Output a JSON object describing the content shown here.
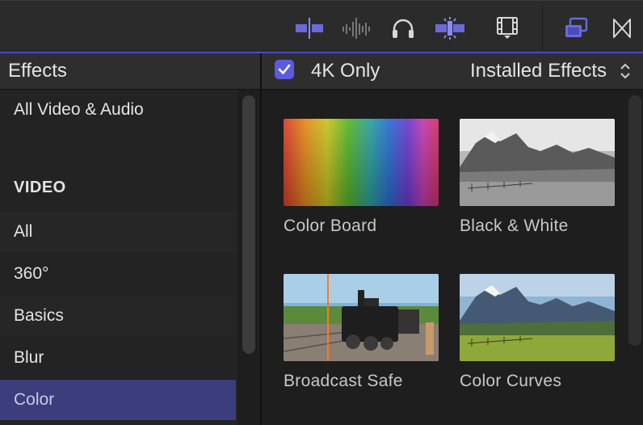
{
  "toolbar": {
    "icons": [
      "split-edit-icon",
      "audio-skimming-icon",
      "headphones-icon",
      "snapping-icon",
      "inspector-filmstrip-icon",
      "window-layout-icon",
      "transitions-bowtie-icon"
    ],
    "accent": "#6666e0"
  },
  "effects_panel": {
    "title": "Effects",
    "items": [
      {
        "label": "All Video & Audio",
        "kind": "item"
      },
      {
        "label": "VIDEO",
        "kind": "header"
      },
      {
        "label": "All",
        "kind": "item"
      },
      {
        "label": "360°",
        "kind": "item"
      },
      {
        "label": "Basics",
        "kind": "item"
      },
      {
        "label": "Blur",
        "kind": "item"
      },
      {
        "label": "Color",
        "kind": "item",
        "selected": true
      }
    ]
  },
  "browser": {
    "filter_checked": true,
    "filter_label": "4K Only",
    "installed_label": "Installed Effects",
    "effects": [
      {
        "label": "Color Board"
      },
      {
        "label": "Black & White"
      },
      {
        "label": "Broadcast Safe"
      },
      {
        "label": "Color Curves"
      }
    ]
  },
  "colors": {
    "selection": "#3b3d7c",
    "checkbox": "#5b5be0"
  }
}
